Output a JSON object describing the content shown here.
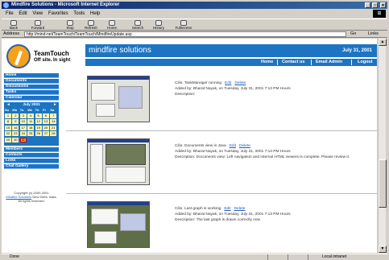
{
  "window": {
    "title": "Mindfire Solutions - Microsoft Internet Explorer",
    "controls": [
      "_",
      "□",
      "✕"
    ],
    "winlogo": "⊞"
  },
  "menu": [
    "File",
    "Edit",
    "View",
    "Favorites",
    "Tools",
    "Help"
  ],
  "toolbar": [
    "Back",
    "Forward",
    "Stop",
    "Refresh",
    "Home",
    "Search",
    "History",
    "Fullscreen"
  ],
  "address": {
    "label": "Address",
    "url": "http://mind-net/TeamTouch/TeamTouch/MindfireUpdate.asp",
    "go": "Go",
    "links": "Links"
  },
  "site": {
    "brand": "TeamTouch",
    "tagline": "Off site. In sight",
    "banner_title": "mindfire solutions",
    "banner_date": "July 31, 2001",
    "nav": [
      "Home",
      "Contact us",
      "Email Admin",
      "Logout"
    ]
  },
  "sidebar": {
    "items_top": [
      "Home",
      "Documents",
      "Discussions",
      "Tasks",
      "Calendar"
    ],
    "calendar": {
      "prev": "◄",
      "month": "July 2001",
      "next": "►",
      "weekdays": [
        "Su",
        "Mo",
        "Tu",
        "We",
        "Th",
        "Fr",
        "Sa"
      ],
      "days": [
        "1",
        "2",
        "3",
        "4",
        "5",
        "6",
        "7",
        "8",
        "9",
        "10",
        "11",
        "12",
        "13",
        "14",
        "15",
        "16",
        "17",
        "18",
        "19",
        "20",
        "21",
        "22",
        "23",
        "24",
        "25",
        "26",
        "27",
        "28",
        "29",
        "30",
        "31"
      ],
      "first_weekday": 0,
      "today": "31"
    },
    "items_bottom": [
      "Members",
      "Contacts",
      "Links",
      "Chat Gallery"
    ],
    "copyright_line1": "Copyright (c) 2000-2001",
    "copyright_link": "Mindfire Solutions",
    "copyright_line2": "New Delhi, India.",
    "copyright_line3": "All rights reserved."
  },
  "entries": [
    {
      "caption": "Cilio: TaskManager running",
      "edit": "Edit",
      "delete": "Delete",
      "author_line": "Added by: Bharat Nayak, on Tuesday, July 31, 2001 7:13 PM Hours",
      "description": "Description:"
    },
    {
      "caption": "Cilio: Documents view in Java",
      "edit": "Edit",
      "delete": "Delete",
      "author_line": "Added by: Bharat Nayak, on Tuesday, July 31, 2001 7:14 PM Hours",
      "description": "Description: Documents view: Left navigation and internal HTML viewers is complete. Please review it."
    },
    {
      "caption": "Cilio: Last graph is working",
      "edit": "Edit",
      "delete": "Delete",
      "author_line": "Added by: Bharat Nayak, on Tuesday, July 31, 2001 7:13 PM Hours",
      "description": "Description: The last graph is drawn correctly now"
    }
  ],
  "status": {
    "left": "Done",
    "zone": "Local intranet"
  }
}
